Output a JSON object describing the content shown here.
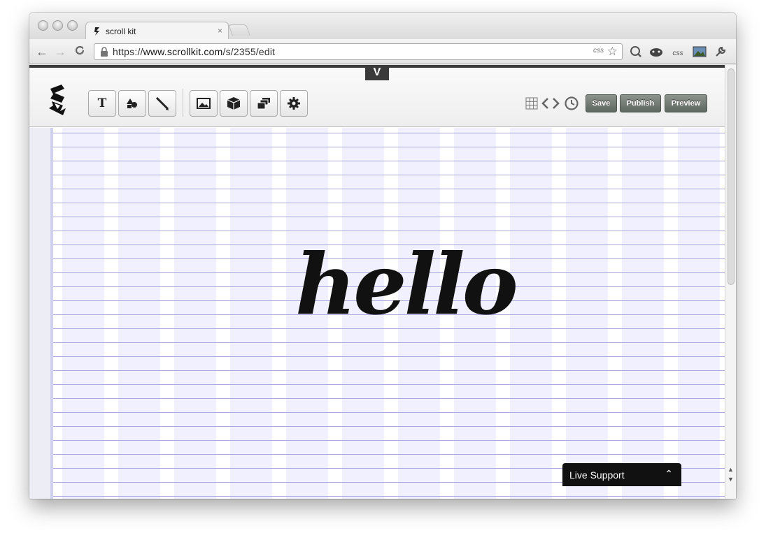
{
  "browser": {
    "tab_title": "scroll kit",
    "tab_close": "×",
    "url_prefix": "https://",
    "url_host": "www.scrollkit.com",
    "url_path": "/s/2355/edit",
    "omnibox_css_badge": "css",
    "star_icon": "☆",
    "back_icon": "←",
    "forward_icon": "→",
    "reload_icon": "C",
    "extensions": [
      "readability-icon",
      "puzzle-icon",
      "css-icon",
      "image-icon",
      "wrench-icon"
    ],
    "extension_labels": [
      "Q",
      "✦",
      "css",
      "▣",
      "🔧"
    ]
  },
  "editor": {
    "drop_toggle": "V",
    "tools": [
      {
        "name": "text-tool",
        "label": "T"
      },
      {
        "name": "shape-tool",
        "label": ""
      },
      {
        "name": "pen-tool",
        "label": ""
      },
      {
        "name": "image-tool",
        "label": ""
      },
      {
        "name": "block-tool",
        "label": ""
      },
      {
        "name": "layers-tool",
        "label": ""
      },
      {
        "name": "settings-tool",
        "label": ""
      }
    ],
    "actions": {
      "save": "Save",
      "publish": "Publish",
      "preview": "Preview"
    },
    "accent": "#5e675f",
    "grid_color": "#a9a9dc",
    "column_color": "#f1f0ff"
  },
  "canvas": {
    "headline": "hello"
  },
  "live_support": {
    "label": "Live Support",
    "chevron": "⌃"
  }
}
